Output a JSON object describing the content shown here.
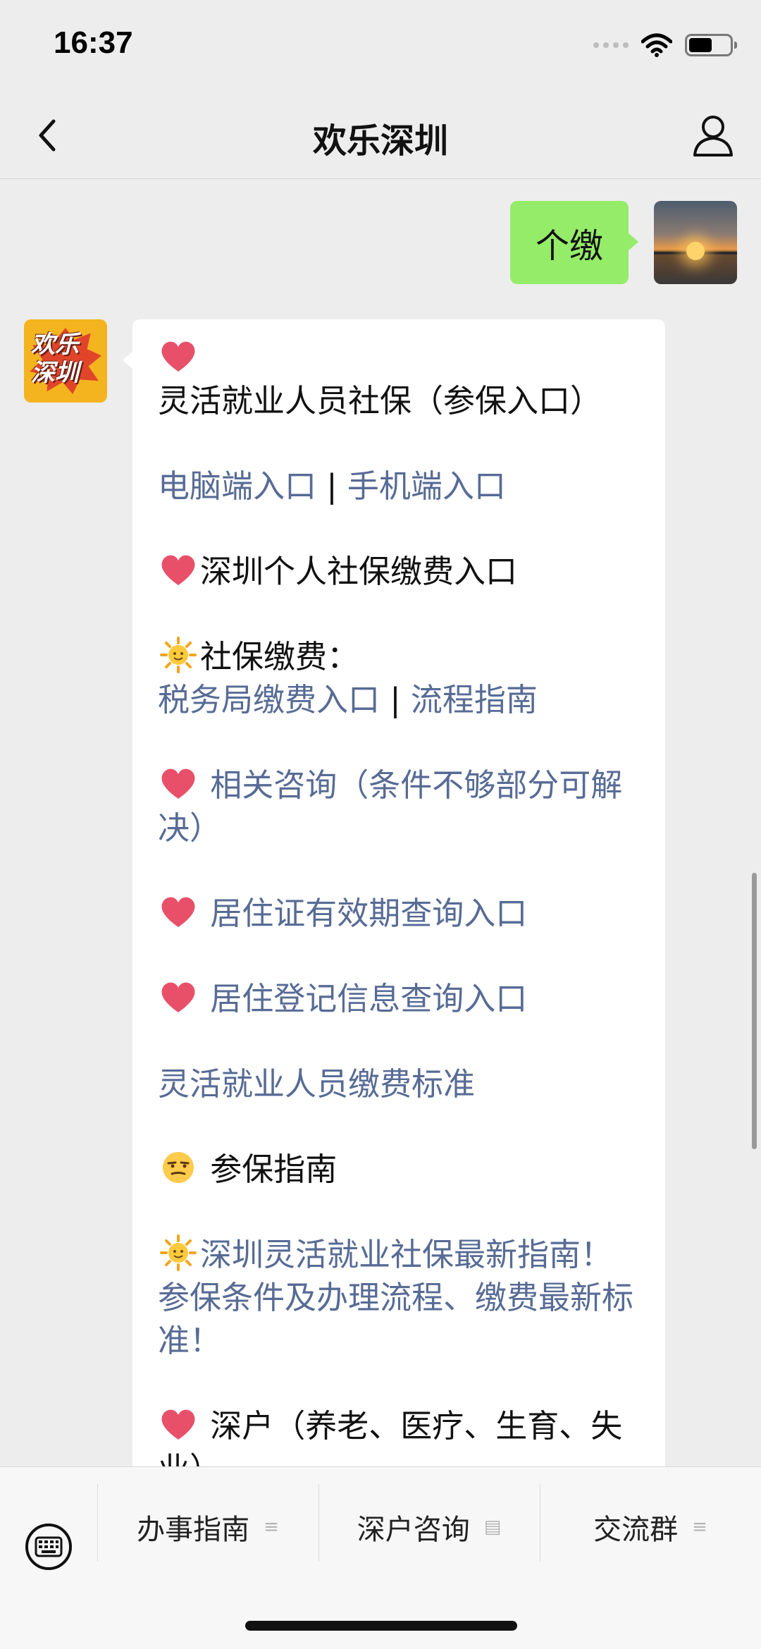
{
  "status_bar": {
    "time": "16:37"
  },
  "nav": {
    "title": "欢乐深圳"
  },
  "user_message": {
    "text": "个缴"
  },
  "bot_avatar": {
    "text": "欢乐深圳"
  },
  "bot_message": {
    "line1_text": "灵活就业人员社保（参保入口）",
    "link_pc": "电脑端入口",
    "separator": "|",
    "link_mobile": "手机端入口",
    "line3_text": "深圳个人社保缴费入口",
    "line4_label": "社保缴费：",
    "link_tax": "税务局缴费入口",
    "link_process": "流程指南",
    "link_consult": " 相关咨询（条件不够部分可解决）",
    "link_residence_permit": " 居住证有效期查询入口",
    "link_residence_register": " 居住登记信息查询入口",
    "link_standard": "灵活就业人员缴费标准",
    "line_guide": " 参保指南",
    "link_latest_guide": "深圳灵活就业社保最新指南！参保条件及办理流程、缴费最新标准！",
    "line_hukou": " 深户（养老、医疗、生育、失业）"
  },
  "bottom_menu": {
    "items": [
      "办事指南",
      "深户咨询",
      "交流群"
    ],
    "icons": [
      "≡",
      "▤",
      "≡"
    ]
  },
  "colors": {
    "link": "#576b95",
    "user_bubble": "#95ec69",
    "background": "#ededed"
  }
}
